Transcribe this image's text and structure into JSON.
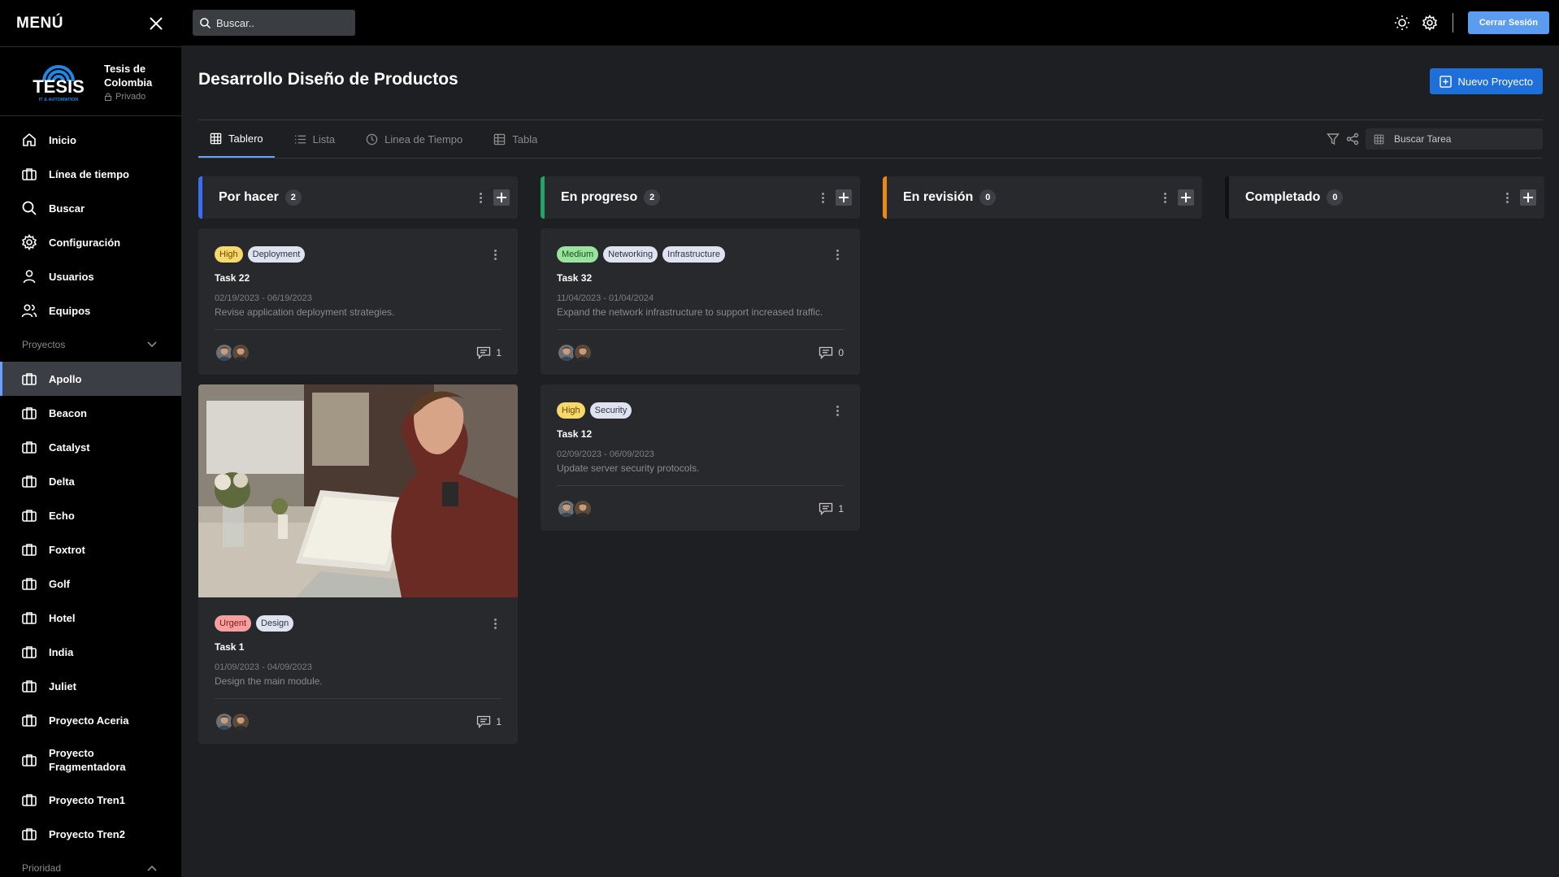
{
  "sidebar": {
    "title": "MENÚ",
    "org": {
      "logo_text": "TESIS",
      "logo_sub": "IT & AUTOMATION",
      "name": "Tesis de Colombia",
      "privacy": "Privado"
    },
    "nav": [
      {
        "label": "Inicio",
        "icon": "home-icon"
      },
      {
        "label": "Línea de tiempo",
        "icon": "briefcase-icon"
      },
      {
        "label": "Buscar",
        "icon": "search-icon"
      },
      {
        "label": "Configuración",
        "icon": "gear-icon"
      },
      {
        "label": "Usuarios",
        "icon": "user-icon"
      },
      {
        "label": "Equipos",
        "icon": "users-icon"
      }
    ],
    "projects_label": "Proyectos",
    "projects": [
      "Apollo",
      "Beacon",
      "Catalyst",
      "Delta",
      "Echo",
      "Foxtrot",
      "Golf",
      "Hotel",
      "India",
      "Juliet",
      "Proyecto Aceria",
      "Proyecto Fragmentadora",
      "Proyecto Tren1",
      "Proyecto Tren2"
    ],
    "active_project": "Apollo",
    "priority_label": "Prioridad"
  },
  "topbar": {
    "search_placeholder": "Buscar..",
    "logout_label": "Cerrar Sesión"
  },
  "main": {
    "title": "Desarrollo Diseño de Productos",
    "new_project_label": "Nuevo Proyecto",
    "tabs": [
      {
        "label": "Tablero",
        "icon": "grid-icon",
        "active": true
      },
      {
        "label": "Lista",
        "icon": "list-icon",
        "active": false
      },
      {
        "label": "Linea de Tiempo",
        "icon": "clock-icon",
        "active": false
      },
      {
        "label": "Tabla",
        "icon": "table-icon",
        "active": false
      }
    ],
    "task_search_placeholder": "Buscar Tarea"
  },
  "board": {
    "columns": [
      {
        "title": "Por hacer",
        "count": "2",
        "color": "#3b6ef5",
        "cards": [
          {
            "tags": [
              {
                "label": "High",
                "kind": "high"
              },
              {
                "label": "Deployment",
                "kind": "gray"
              }
            ],
            "title": "Task 22",
            "dates": "02/19/2023 - 06/19/2023",
            "desc": "Revise application deployment strategies.",
            "comments": "1",
            "image": false
          },
          {
            "tags": [
              {
                "label": "Urgent",
                "kind": "urgent"
              },
              {
                "label": "Design",
                "kind": "gray"
              }
            ],
            "title": "Task 1",
            "dates": "01/09/2023 - 04/09/2023",
            "desc": "Design the main module.",
            "comments": "1",
            "image": true
          }
        ]
      },
      {
        "title": "En progreso",
        "count": "2",
        "color": "#22a466",
        "cards": [
          {
            "tags": [
              {
                "label": "Medium",
                "kind": "medium"
              },
              {
                "label": "Networking",
                "kind": "gray"
              },
              {
                "label": "Infrastructure",
                "kind": "gray"
              }
            ],
            "title": "Task 32",
            "dates": "11/04/2023 - 01/04/2024",
            "desc": "Expand the network infrastructure to support increased traffic.",
            "comments": "0",
            "image": false
          },
          {
            "tags": [
              {
                "label": "High",
                "kind": "high"
              },
              {
                "label": "Security",
                "kind": "gray"
              }
            ],
            "title": "Task 12",
            "dates": "02/09/2023 - 06/09/2023",
            "desc": "Update server security protocols.",
            "comments": "1",
            "image": false
          }
        ]
      },
      {
        "title": "En revisión",
        "count": "0",
        "color": "#e88a12",
        "cards": []
      },
      {
        "title": "Completado",
        "count": "0",
        "color": "#111111",
        "cards": []
      }
    ]
  }
}
